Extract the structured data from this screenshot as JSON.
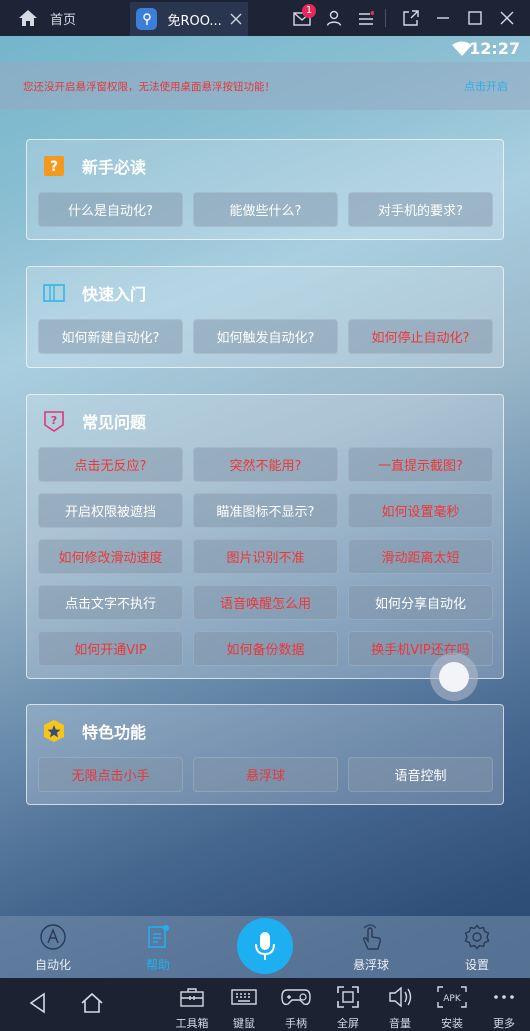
{
  "titlebar": {
    "home_label": "首页",
    "tab_label": "免ROO...",
    "mail_badge": "1"
  },
  "status": {
    "time": "12:27"
  },
  "banner": {
    "message": "您还没开启悬浮窗权限，无法使用桌面悬浮按钮功能！",
    "action": "点击开启"
  },
  "sections": [
    {
      "title": "新手必读",
      "icon": "question-square-icon",
      "items": [
        {
          "label": "什么是自动化?",
          "color": "white"
        },
        {
          "label": "能做些什么?",
          "color": "white"
        },
        {
          "label": "对手机的要求?",
          "color": "white"
        }
      ]
    },
    {
      "title": "快速入门",
      "icon": "book-icon",
      "items": [
        {
          "label": "如何新建自动化?",
          "color": "white"
        },
        {
          "label": "如何触发自动化?",
          "color": "white"
        },
        {
          "label": "如何停止自动化?",
          "color": "red"
        }
      ]
    },
    {
      "title": "常见问题",
      "icon": "question-shield-icon",
      "items": [
        {
          "label": "点击无反应?",
          "color": "red"
        },
        {
          "label": "突然不能用?",
          "color": "red"
        },
        {
          "label": "一直提示截图?",
          "color": "red"
        },
        {
          "label": "开启权限被遮挡",
          "color": "white"
        },
        {
          "label": "瞄准图标不显示?",
          "color": "white"
        },
        {
          "label": "如何设置毫秒",
          "color": "red"
        },
        {
          "label": "如何修改滑动速度",
          "color": "red"
        },
        {
          "label": "图片识别不准",
          "color": "red"
        },
        {
          "label": "滑动距离太短",
          "color": "red"
        },
        {
          "label": "点击文字不执行",
          "color": "white"
        },
        {
          "label": "语音唤醒怎么用",
          "color": "red"
        },
        {
          "label": "如何分享自动化",
          "color": "white"
        },
        {
          "label": "如何开通VIP",
          "color": "red"
        },
        {
          "label": "如何备份数据",
          "color": "red"
        },
        {
          "label": "换手机VIP还在吗",
          "color": "red"
        }
      ]
    },
    {
      "title": "特色功能",
      "icon": "star-badge-icon",
      "items": [
        {
          "label": "无限点击小手",
          "color": "red"
        },
        {
          "label": "悬浮球",
          "color": "red"
        },
        {
          "label": "语音控制",
          "color": "white"
        }
      ]
    }
  ],
  "bottom_nav": {
    "automation": "自动化",
    "help": "帮助",
    "float_ball": "悬浮球",
    "settings": "设置",
    "active": "help"
  },
  "toolbar": {
    "toolbox": "工具箱",
    "keyboard": "键鼠",
    "gamepad": "手柄",
    "fullscreen": "全屏",
    "volume": "音量",
    "install": "安装",
    "more": "更多"
  },
  "colors": {
    "accent": "#1eaef2",
    "alert_red": "#ee3636",
    "title_bar": "#1c2436"
  }
}
